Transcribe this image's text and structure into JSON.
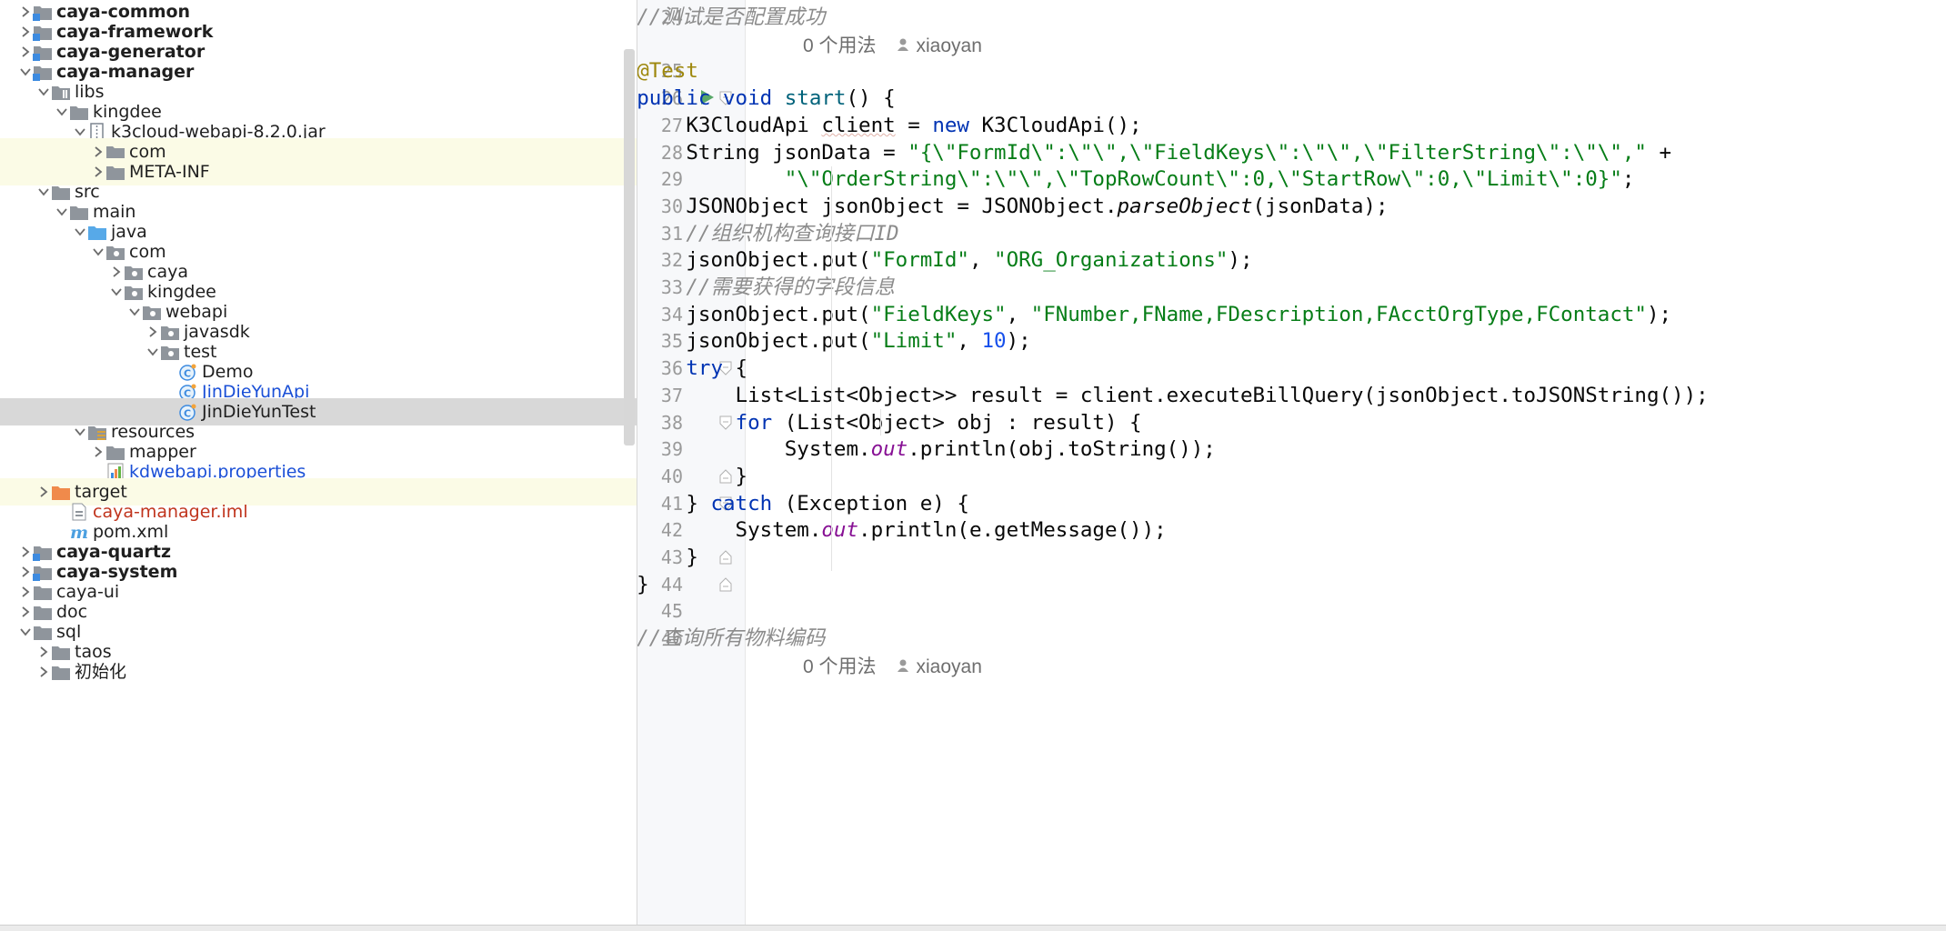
{
  "project_tree": {
    "rows": [
      {
        "label": "caya-common",
        "depth": 0,
        "state": "collapsed",
        "icon": "module-folder-icon",
        "style": "bold"
      },
      {
        "label": "caya-framework",
        "depth": 0,
        "state": "collapsed",
        "icon": "module-folder-icon",
        "style": "bold"
      },
      {
        "label": "caya-generator",
        "depth": 0,
        "state": "collapsed",
        "icon": "module-folder-icon",
        "style": "bold"
      },
      {
        "label": "caya-manager",
        "depth": 0,
        "state": "expanded",
        "icon": "module-folder-icon",
        "style": "bold"
      },
      {
        "label": "libs",
        "depth": 1,
        "state": "expanded",
        "icon": "library-folder-icon",
        "style": "normal"
      },
      {
        "label": "kingdee",
        "depth": 2,
        "state": "expanded",
        "icon": "folder-icon",
        "style": "normal"
      },
      {
        "label": "k3cloud-webapi-8.2.0.jar",
        "depth": 3,
        "state": "expanded",
        "icon": "jar-icon",
        "style": "normal"
      },
      {
        "label": "com",
        "depth": 4,
        "state": "collapsed",
        "icon": "folder-icon",
        "style": "normal",
        "highlight": true
      },
      {
        "label": "META-INF",
        "depth": 4,
        "state": "collapsed",
        "icon": "folder-icon",
        "style": "normal",
        "highlight": true
      },
      {
        "label": "src",
        "depth": 1,
        "state": "expanded",
        "icon": "folder-icon",
        "style": "normal"
      },
      {
        "label": "main",
        "depth": 2,
        "state": "expanded",
        "icon": "folder-icon",
        "style": "normal"
      },
      {
        "label": "java",
        "depth": 3,
        "state": "expanded",
        "icon": "source-folder-icon",
        "style": "normal"
      },
      {
        "label": "com",
        "depth": 4,
        "state": "expanded",
        "icon": "package-icon",
        "style": "normal"
      },
      {
        "label": "caya",
        "depth": 5,
        "state": "collapsed",
        "icon": "package-icon",
        "style": "normal"
      },
      {
        "label": "kingdee",
        "depth": 5,
        "state": "expanded",
        "icon": "package-icon",
        "style": "normal"
      },
      {
        "label": "webapi",
        "depth": 6,
        "state": "expanded",
        "icon": "package-icon",
        "style": "normal"
      },
      {
        "label": "javasdk",
        "depth": 7,
        "state": "collapsed",
        "icon": "package-icon",
        "style": "normal"
      },
      {
        "label": "test",
        "depth": 7,
        "state": "expanded",
        "icon": "package-icon",
        "style": "normal"
      },
      {
        "label": "Demo",
        "depth": 8,
        "state": "leaf",
        "icon": "java-class-icon",
        "style": "normal"
      },
      {
        "label": "JinDieYunApi",
        "depth": 8,
        "state": "leaf",
        "icon": "java-class-icon",
        "style": "blue"
      },
      {
        "label": "JinDieYunTest",
        "depth": 8,
        "state": "leaf",
        "icon": "java-class-icon",
        "style": "normal",
        "selected": true
      },
      {
        "label": "resources",
        "depth": 3,
        "state": "expanded",
        "icon": "resources-folder-icon",
        "style": "normal"
      },
      {
        "label": "mapper",
        "depth": 4,
        "state": "collapsed",
        "icon": "folder-icon",
        "style": "normal"
      },
      {
        "label": "kdwebapi.properties",
        "depth": 4,
        "state": "leaf",
        "icon": "properties-file-icon",
        "style": "blue"
      },
      {
        "label": "target",
        "depth": 1,
        "state": "collapsed",
        "icon": "excluded-folder-icon",
        "style": "normal",
        "highlight": true
      },
      {
        "label": "caya-manager.iml",
        "depth": 2,
        "state": "leaf",
        "icon": "iml-file-icon",
        "style": "red"
      },
      {
        "label": "pom.xml",
        "depth": 2,
        "state": "leaf",
        "icon": "maven-icon",
        "style": "normal"
      },
      {
        "label": "caya-quartz",
        "depth": 0,
        "state": "collapsed",
        "icon": "module-folder-icon",
        "style": "bold"
      },
      {
        "label": "caya-system",
        "depth": 0,
        "state": "collapsed",
        "icon": "module-folder-icon",
        "style": "bold"
      },
      {
        "label": "caya-ui",
        "depth": 0,
        "state": "collapsed",
        "icon": "folder-icon",
        "style": "normal"
      },
      {
        "label": "doc",
        "depth": 0,
        "state": "collapsed",
        "icon": "folder-icon",
        "style": "normal"
      },
      {
        "label": "sql",
        "depth": 0,
        "state": "expanded",
        "icon": "folder-icon",
        "style": "normal"
      },
      {
        "label": "taos",
        "depth": 1,
        "state": "collapsed",
        "icon": "folder-icon",
        "style": "normal"
      },
      {
        "label": "初始化",
        "depth": 1,
        "state": "collapsed",
        "icon": "folder-icon",
        "style": "normal"
      }
    ]
  },
  "editor": {
    "usage_hint": "0 个用法",
    "author": "xiaoyan",
    "lines": [
      {
        "kind": "code",
        "no": "24",
        "tokens": [
          {
            "t": "    "
          },
          {
            "t": "//测试是否配置成功",
            "c": "c"
          }
        ]
      },
      {
        "kind": "hint"
      },
      {
        "kind": "code",
        "no": "25",
        "tokens": [
          {
            "t": "    "
          },
          {
            "t": "@Test",
            "c": "a"
          }
        ]
      },
      {
        "kind": "code",
        "no": "26",
        "run": true,
        "fold": "open",
        "tokens": [
          {
            "t": "    "
          },
          {
            "t": "public",
            "c": "k"
          },
          {
            "t": " "
          },
          {
            "t": "void",
            "c": "k"
          },
          {
            "t": " "
          },
          {
            "t": "start",
            "c": "fn"
          },
          {
            "t": "() {"
          }
        ]
      },
      {
        "kind": "code",
        "no": "27",
        "tokens": [
          {
            "t": "        K3CloudApi "
          },
          {
            "t": "client",
            "c": "squig"
          },
          {
            "t": " = "
          },
          {
            "t": "new",
            "c": "k"
          },
          {
            "t": " K3CloudApi();"
          }
        ]
      },
      {
        "kind": "code",
        "no": "28",
        "tokens": [
          {
            "t": "        String jsonData = "
          },
          {
            "t": "\"{\\\"FormId\\\":\\\"\\\",\\\"FieldKeys\\\":\\\"\\\",\\\"FilterString\\\":\\\"\\\",\"",
            "c": "s"
          },
          {
            "t": " +"
          }
        ]
      },
      {
        "kind": "code",
        "no": "29",
        "tokens": [
          {
            "t": "                "
          },
          {
            "t": "\"\\\"OrderString\\\":\\\"\\\",\\\"TopRowCount\\\":0,\\\"StartRow\\\":0,\\\"Limit\\\":0}\"",
            "c": "s"
          },
          {
            "t": ";"
          }
        ]
      },
      {
        "kind": "code",
        "no": "30",
        "tokens": [
          {
            "t": "        JSONObject jsonObject = JSONObject."
          },
          {
            "t": "parseObject",
            "c": "it"
          },
          {
            "t": "(jsonData);"
          }
        ]
      },
      {
        "kind": "code",
        "no": "31",
        "tokens": [
          {
            "t": "        "
          },
          {
            "t": "//组织机构查询接口ID",
            "c": "c"
          }
        ]
      },
      {
        "kind": "code",
        "no": "32",
        "tokens": [
          {
            "t": "        jsonObject.put("
          },
          {
            "t": "\"FormId\"",
            "c": "s"
          },
          {
            "t": ", "
          },
          {
            "t": "\"ORG_Organizations\"",
            "c": "s"
          },
          {
            "t": ");"
          }
        ]
      },
      {
        "kind": "code",
        "no": "33",
        "tokens": [
          {
            "t": "        "
          },
          {
            "t": "//需要获得的字段信息",
            "c": "c"
          }
        ]
      },
      {
        "kind": "code",
        "no": "34",
        "tokens": [
          {
            "t": "        jsonObject.put("
          },
          {
            "t": "\"FieldKeys\"",
            "c": "s"
          },
          {
            "t": ", "
          },
          {
            "t": "\"FNumber,FName,FDescription,FAcctOrgType,FContact\"",
            "c": "s"
          },
          {
            "t": ");"
          }
        ]
      },
      {
        "kind": "code",
        "no": "35",
        "tokens": [
          {
            "t": "        jsonObject.put("
          },
          {
            "t": "\"Limit\"",
            "c": "s"
          },
          {
            "t": ", "
          },
          {
            "t": "10",
            "c": "n"
          },
          {
            "t": ");"
          }
        ]
      },
      {
        "kind": "code",
        "no": "36",
        "fold": "open",
        "tokens": [
          {
            "t": "        "
          },
          {
            "t": "try",
            "c": "k"
          },
          {
            "t": " {"
          }
        ]
      },
      {
        "kind": "code",
        "no": "37",
        "tokens": [
          {
            "t": "            List<List<Object>> result = client.executeBillQuery(jsonObject.toJSONString());"
          }
        ]
      },
      {
        "kind": "code",
        "no": "38",
        "fold": "open",
        "tokens": [
          {
            "t": "            "
          },
          {
            "t": "for",
            "c": "k"
          },
          {
            "t": " (List<Object> obj : result) {"
          }
        ]
      },
      {
        "kind": "code",
        "no": "39",
        "tokens": [
          {
            "t": "                System."
          },
          {
            "t": "out",
            "c": "f"
          },
          {
            "t": ".println(obj.toString());"
          }
        ]
      },
      {
        "kind": "code",
        "no": "40",
        "fold": "close",
        "tokens": [
          {
            "t": "            }"
          }
        ]
      },
      {
        "kind": "code",
        "no": "41",
        "fold": "open",
        "tokens": [
          {
            "t": "        } "
          },
          {
            "t": "catch",
            "c": "k"
          },
          {
            "t": " (Exception e) {"
          }
        ]
      },
      {
        "kind": "code",
        "no": "42",
        "tokens": [
          {
            "t": "            System."
          },
          {
            "t": "out",
            "c": "f"
          },
          {
            "t": ".println(e.getMessage());"
          }
        ]
      },
      {
        "kind": "code",
        "no": "43",
        "fold": "close",
        "tokens": [
          {
            "t": "        }"
          }
        ]
      },
      {
        "kind": "code",
        "no": "44",
        "fold": "close",
        "tokens": [
          {
            "t": "    }"
          }
        ]
      },
      {
        "kind": "code",
        "no": "45",
        "tokens": []
      },
      {
        "kind": "code",
        "no": "46",
        "tokens": [
          {
            "t": "    "
          },
          {
            "t": "//查询所有物料编码",
            "c": "c"
          }
        ]
      },
      {
        "kind": "hint"
      }
    ]
  },
  "colors": {
    "keyword": "#0033b3",
    "string": "#067d17",
    "comment": "#8c8c8c",
    "annotation": "#9e880d",
    "number": "#1750eb",
    "static_field": "#871094",
    "selection_bg": "#d8d8d8",
    "highlight_bg": "#fbfbe6"
  }
}
